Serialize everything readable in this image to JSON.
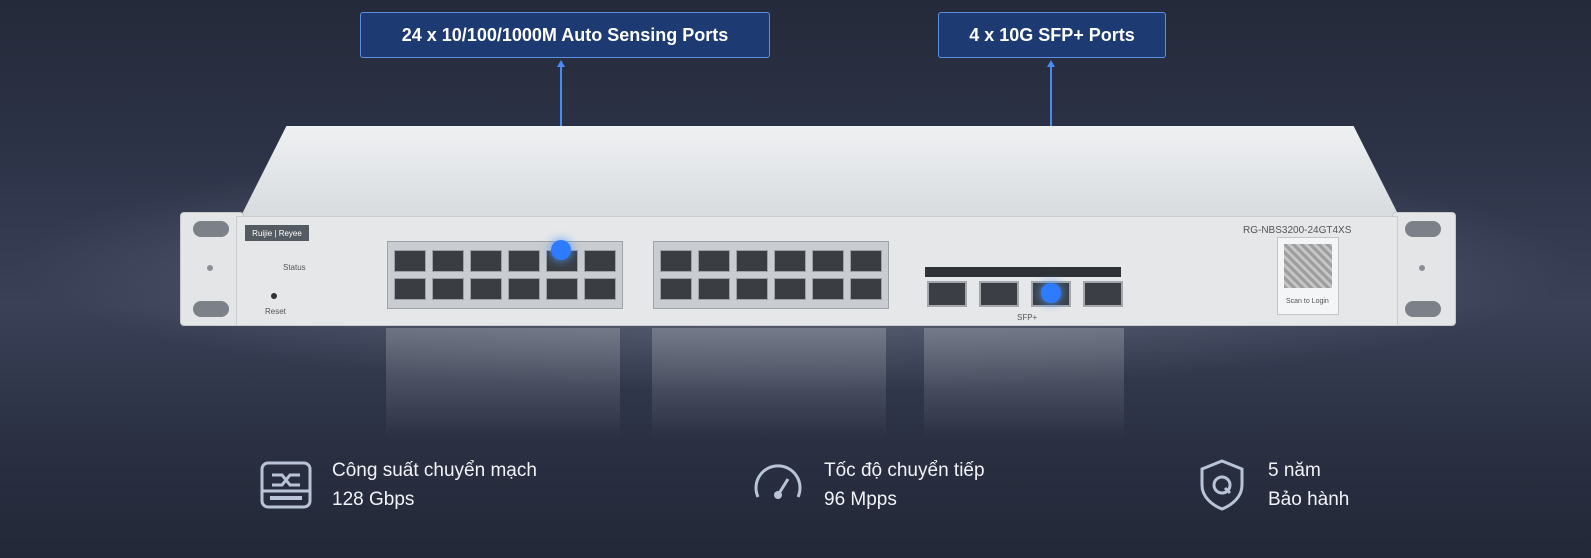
{
  "callouts": {
    "left": "24 x 10/100/1000M Auto Sensing Ports",
    "right": "4 x 10G SFP+ Ports"
  },
  "device": {
    "brand": "Ruijie | Reyee",
    "model": "RG-NBS3200-24GT4XS",
    "reset_label": "Reset",
    "status_label": "Status",
    "scan_label": "Scan to Login",
    "sfp_label": "SFP+"
  },
  "features": [
    {
      "icon": "switch-icon",
      "line1": "Công suất chuyển mạch",
      "line2": "128 Gbps"
    },
    {
      "icon": "speedometer-icon",
      "line1": "Tốc độ chuyển tiếp",
      "line2": "96 Mpps"
    },
    {
      "icon": "shield-icon",
      "line1": "5 năm",
      "line2": "Bảo hành"
    }
  ],
  "colors": {
    "accent": "#2f7bff",
    "callout_bg": "#1d3a73"
  }
}
